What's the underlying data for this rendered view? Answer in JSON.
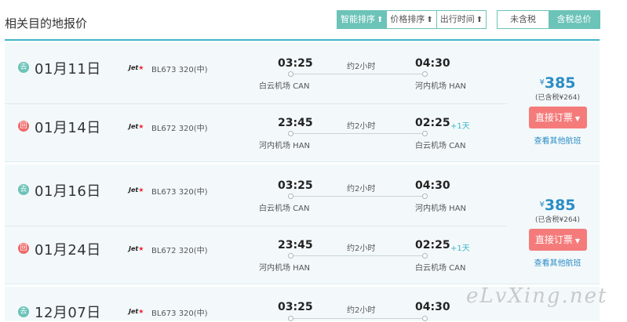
{
  "header": {
    "title": "相关目的地报价",
    "sort_buttons": [
      {
        "label": "智能排序",
        "icon": "arrow-up-icon",
        "active": true
      },
      {
        "label": "价格排序",
        "icon": "arrow-up-icon",
        "active": false
      },
      {
        "label": "出行时间",
        "icon": "arrow-up-icon",
        "active": false
      }
    ],
    "tax_toggle": {
      "pre_tax": "未含税",
      "with_tax": "含税总价"
    }
  },
  "glyphs": {
    "arrow_up": "⬆",
    "chevron": "▼"
  },
  "cards": [
    {
      "price_currency": "¥",
      "price": "385",
      "tax_note": "(已含税¥264)",
      "book_label": "直接订票",
      "other_label": "查看其他航班",
      "legs": [
        {
          "badge": "去",
          "date": "01月11日",
          "airline": "Jet",
          "flight": "BL673 320(中)",
          "dep_time": "03:25",
          "duration": "约2小时",
          "arr_time": "04:30",
          "next_day": "",
          "dep_airport": "白云机场 CAN",
          "arr_airport": "河内机场 HAN"
        },
        {
          "badge": "回",
          "date": "01月14日",
          "airline": "Jet",
          "flight": "BL672 320(中)",
          "dep_time": "23:45",
          "duration": "约2小时",
          "arr_time": "02:25",
          "next_day": "+1天",
          "dep_airport": "河内机场 HAN",
          "arr_airport": "白云机场 CAN"
        }
      ]
    },
    {
      "price_currency": "¥",
      "price": "385",
      "tax_note": "(已含税¥264)",
      "book_label": "直接订票",
      "other_label": "查看其他航班",
      "legs": [
        {
          "badge": "去",
          "date": "01月16日",
          "airline": "Jet",
          "flight": "BL673 320(中)",
          "dep_time": "03:25",
          "duration": "约2小时",
          "arr_time": "04:30",
          "next_day": "",
          "dep_airport": "白云机场 CAN",
          "arr_airport": "河内机场 HAN"
        },
        {
          "badge": "回",
          "date": "01月24日",
          "airline": "Jet",
          "flight": "BL672 320(中)",
          "dep_time": "23:45",
          "duration": "约2小时",
          "arr_time": "02:25",
          "next_day": "+1天",
          "dep_airport": "河内机场 HAN",
          "arr_airport": "白云机场 CAN"
        }
      ]
    },
    {
      "legs": [
        {
          "badge": "去",
          "date": "12月07日",
          "airline": "Jet",
          "flight": "BL673 320(中)",
          "dep_time": "03:25",
          "duration": "约2小时",
          "arr_time": "04:30",
          "next_day": ""
        }
      ]
    }
  ],
  "watermark": "eLvXing.net"
}
